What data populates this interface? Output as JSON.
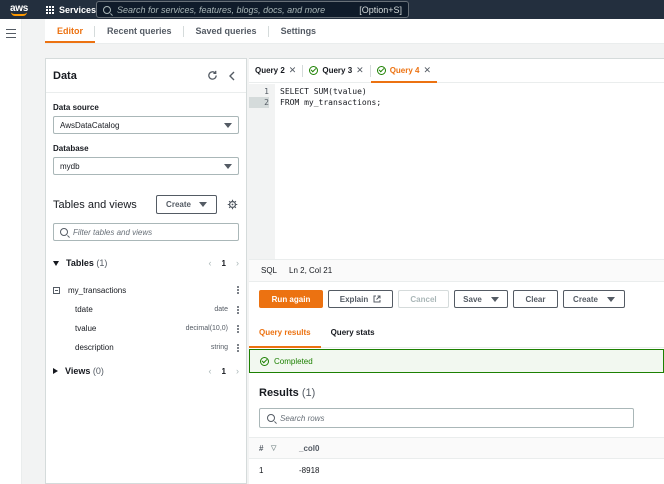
{
  "topnav": {
    "logo": "aws",
    "services": "Services",
    "search_placeholder": "Search for services, features, blogs, docs, and more",
    "search_shortcut": "[Option+S]"
  },
  "main_tabs": [
    "Editor",
    "Recent queries",
    "Saved queries",
    "Settings"
  ],
  "data_panel": {
    "title": "Data",
    "data_source_label": "Data source",
    "data_source_value": "AwsDataCatalog",
    "database_label": "Database",
    "database_value": "mydb",
    "tables_views_title": "Tables and views",
    "create_button": "Create",
    "filter_placeholder": "Filter tables and views",
    "tables_label": "Tables",
    "tables_count": "(1)",
    "tables_page": "1",
    "table_name": "my_transactions",
    "columns": [
      {
        "name": "tdate",
        "type": "date"
      },
      {
        "name": "tvalue",
        "type": "decimal(10,0)"
      },
      {
        "name": "description",
        "type": "string"
      }
    ],
    "views_label": "Views",
    "views_count": "(0)",
    "views_page": "1"
  },
  "query_tabs": [
    {
      "label": "Query 2",
      "status": "none"
    },
    {
      "label": "Query 3",
      "status": "completed"
    },
    {
      "label": "Query 4",
      "status": "completed",
      "active": true
    }
  ],
  "editor": {
    "lines": [
      {
        "num": "1",
        "text": "SELECT SUM(tvalue)"
      },
      {
        "num": "2",
        "text": "FROM my_transactions;"
      }
    ],
    "mode": "SQL",
    "cursor": "Ln 2, Col 21"
  },
  "actions": {
    "run": "Run again",
    "explain": "Explain",
    "cancel": "Cancel",
    "save": "Save",
    "clear": "Clear",
    "create": "Create"
  },
  "result_tabs": [
    "Query results",
    "Query stats"
  ],
  "status_message": "Completed",
  "results": {
    "title": "Results",
    "count": "(1)",
    "search_placeholder": "Search rows",
    "headers": [
      "#",
      "_col0"
    ],
    "rows": [
      [
        "1",
        "-8918"
      ]
    ]
  },
  "colors": {
    "accent": "#ec7211",
    "nav": "#232f3e",
    "success": "#1d8102"
  }
}
